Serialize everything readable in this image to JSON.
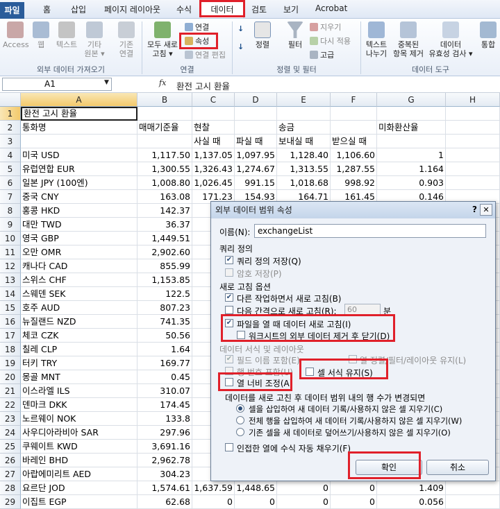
{
  "tabs": [
    "파일",
    "홈",
    "삽입",
    "페이지 레이아웃",
    "수식",
    "데이터",
    "검토",
    "보기",
    "Acrobat"
  ],
  "ribbon": {
    "access": "Access",
    "web": "웹",
    "text": "텍스트",
    "other": "기타\n원본 ▾",
    "existing": "기존\n연결",
    "refresh_all": "모두 새로\n고침 ▾",
    "connections": "연결",
    "properties": "속성",
    "edit_links": "연결 편집",
    "sort": "정렬",
    "filter": "필터",
    "clear": "지우기",
    "reapply": "다시 적용",
    "advanced": "고급",
    "text_to_columns": "텍스트\n나누기",
    "remove_dup": "중복된\n항목 제거",
    "validation": "데이터\n유효성 검사 ▾",
    "consolidate": "통합",
    "group_external": "외부 데이터 가져오기",
    "group_connections": "연결",
    "group_sort": "정렬 및 필터",
    "group_tools": "데이터 도구"
  },
  "formula_bar": {
    "namebox": "A1",
    "fx": "fx",
    "value": "환전 고시 환율"
  },
  "columns": [
    "A",
    "B",
    "C",
    "D",
    "E",
    "F",
    "G",
    "H"
  ],
  "rows": [
    {
      "n": "1",
      "a": "환전 고시 환율",
      "b": "",
      "c": "",
      "d": "",
      "e": "",
      "f": "",
      "g": ""
    },
    {
      "n": "2",
      "a": "통화명",
      "b": "매매기준율",
      "c": "현찰",
      "d": "",
      "e": "송금",
      "f": "",
      "g": "미화환산율"
    },
    {
      "n": "3",
      "a": "",
      "b": "",
      "c": "사실 때",
      "d": "파실 때",
      "e": "보내실 때",
      "f": "받으실 때",
      "g": ""
    },
    {
      "n": "4",
      "a": "미국 USD",
      "b": "1,117.50",
      "c": "1,137.05",
      "d": "1,097.95",
      "e": "1,128.40",
      "f": "1,106.60",
      "g": "1"
    },
    {
      "n": "5",
      "a": "유럽연합 EUR",
      "b": "1,300.55",
      "c": "1,326.43",
      "d": "1,274.67",
      "e": "1,313.55",
      "f": "1,287.55",
      "g": "1.164"
    },
    {
      "n": "6",
      "a": "일본 JPY (100엔)",
      "b": "1,008.80",
      "c": "1,026.45",
      "d": "991.15",
      "e": "1,018.68",
      "f": "998.92",
      "g": "0.903"
    },
    {
      "n": "7",
      "a": "중국 CNY",
      "b": "163.08",
      "c": "171.23",
      "d": "154.93",
      "e": "164.71",
      "f": "161.45",
      "g": "0.146"
    },
    {
      "n": "8",
      "a": "홍콩 HKD",
      "b": "142.37",
      "c": "",
      "d": "",
      "e": "",
      "f": "",
      "g": ""
    },
    {
      "n": "9",
      "a": "대만 TWD",
      "b": "36.37",
      "c": "",
      "d": "",
      "e": "",
      "f": "",
      "g": ""
    },
    {
      "n": "10",
      "a": "영국 GBP",
      "b": "1,449.51",
      "c": "1,4",
      "d": "",
      "e": "",
      "f": "",
      "g": ""
    },
    {
      "n": "11",
      "a": "오만 OMR",
      "b": "2,902.60",
      "c": "3,0",
      "d": "",
      "e": "",
      "f": "",
      "g": ""
    },
    {
      "n": "12",
      "a": "캐나다 CAD",
      "b": "855.99",
      "c": "8",
      "d": "",
      "e": "",
      "f": "",
      "g": ""
    },
    {
      "n": "13",
      "a": "스위스 CHF",
      "b": "1,153.85",
      "c": "1,1",
      "d": "",
      "e": "",
      "f": "",
      "g": ""
    },
    {
      "n": "14",
      "a": "스웨덴 SEK",
      "b": "122.5",
      "c": "",
      "d": "",
      "e": "",
      "f": "",
      "g": ""
    },
    {
      "n": "15",
      "a": "호주 AUD",
      "b": "807.23",
      "c": "8",
      "d": "",
      "e": "",
      "f": "",
      "g": ""
    },
    {
      "n": "16",
      "a": "뉴질랜드 NZD",
      "b": "741.35",
      "c": "7",
      "d": "",
      "e": "",
      "f": "",
      "g": ""
    },
    {
      "n": "17",
      "a": "체코 CZK",
      "b": "50.56",
      "c": "",
      "d": "",
      "e": "",
      "f": "",
      "g": ""
    },
    {
      "n": "18",
      "a": "칠레 CLP",
      "b": "1.64",
      "c": "",
      "d": "",
      "e": "",
      "f": "",
      "g": ""
    },
    {
      "n": "19",
      "a": "터키 TRY",
      "b": "169.77",
      "c": "1",
      "d": "",
      "e": "",
      "f": "",
      "g": ""
    },
    {
      "n": "20",
      "a": "몽골 MNT",
      "b": "0.45",
      "c": "",
      "d": "",
      "e": "",
      "f": "",
      "g": ""
    },
    {
      "n": "21",
      "a": "이스라엘 ILS",
      "b": "310.07",
      "c": "3",
      "d": "",
      "e": "",
      "f": "",
      "g": ""
    },
    {
      "n": "22",
      "a": "덴마크 DKK",
      "b": "174.45",
      "c": "1",
      "d": "",
      "e": "",
      "f": "",
      "g": ""
    },
    {
      "n": "23",
      "a": "노르웨이 NOK",
      "b": "133.8",
      "c": "1",
      "d": "",
      "e": "",
      "f": "",
      "g": ""
    },
    {
      "n": "24",
      "a": "사우디아라비아 SAR",
      "b": "297.96",
      "c": "3",
      "d": "",
      "e": "",
      "f": "",
      "g": ""
    },
    {
      "n": "25",
      "a": "쿠웨이트 KWD",
      "b": "3,691.16",
      "c": "3,8",
      "d": "",
      "e": "",
      "f": "",
      "g": ""
    },
    {
      "n": "26",
      "a": "바레인 BHD",
      "b": "2,962.78",
      "c": "3,0",
      "d": "",
      "e": "",
      "f": "",
      "g": ""
    },
    {
      "n": "27",
      "a": "아랍에미리트 AED",
      "b": "304.23",
      "c": "3",
      "d": "",
      "e": "",
      "f": "",
      "g": ""
    },
    {
      "n": "28",
      "a": "요르단 JOD",
      "b": "1,574.61",
      "c": "1,637.59",
      "d": "1,448.65",
      "e": "0",
      "f": "0",
      "g": "1.409"
    },
    {
      "n": "29",
      "a": "이집트 EGP",
      "b": "62.68",
      "c": "0",
      "d": "0",
      "e": "0",
      "f": "0",
      "g": "0.056"
    }
  ],
  "dialog": {
    "title": "외부 데이터 범위 속성",
    "name_label": "이름(N):",
    "name_value": "exchangeList",
    "query_def": "쿼리 정의",
    "save_query": "쿼리 정의 저장(Q)",
    "save_password": "암호 저장(P)",
    "refresh_opts": "새로 고침 옵션",
    "bg_refresh": "다른 작업하면서 새로 고침(B)",
    "refresh_every": "다음 간격으로 새로 고침(R):",
    "refresh_minutes": "60",
    "minutes_unit": "분",
    "refresh_on_open": "파일을 열 때 데이터 새로 고침(I)",
    "remove_external": "워크시트의 외부 데이터 제거 후 닫기(D)",
    "data_format": "데이터 서식 및 레이아웃",
    "include_field_names": "필드 이름 포함(E)",
    "preserve_sort": "열 정렬/필터/레이아웃 유지(L)",
    "include_row_numbers": "행 번호 포함(U)",
    "adjust_width": "열 너비 조정(A)",
    "preserve_cell_format": "셀 서식 유지(S)",
    "change_title": "데이터를 새로 고친 후 데이터 범위 내의 행 수가 변경되면",
    "opt_insert_cells": "셀을 삽입하여 새 데이터 기록/사용하지 않은 셀 지우기(C)",
    "opt_insert_rows": "전체 행을 삽입하여 새 데이터 기록/사용하지 않은 셀 지우기(W)",
    "opt_overwrite": "기존 셀을 새 데이터로 덮어쓰기/사용하지 않은 셀 지우기(O)",
    "fill_down": "인접한 열에 수식 자동 채우기(F)",
    "ok": "확인",
    "cancel": "취소"
  }
}
